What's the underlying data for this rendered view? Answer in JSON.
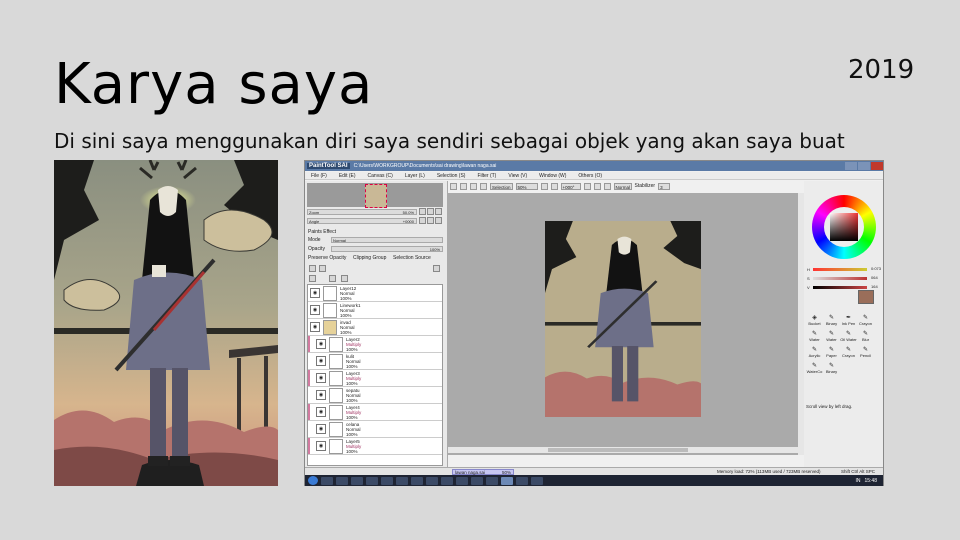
{
  "slide": {
    "title": "Karya saya",
    "year": "2019",
    "subtitle": "Di sini saya menggunakan diri saya sendiri sebagai  objek yang akan saya buat"
  },
  "sai": {
    "logo": "PaintTool SAI",
    "path": "C:\\Users\\WORKGROUP\\Documents\\sai drawing\\lawan naga.sai",
    "menu": [
      "File (F)",
      "Edit (E)",
      "Canvas (C)",
      "Layer (L)",
      "Selection (S)",
      "Filter (T)",
      "View (V)",
      "Window (W)",
      "Others (O)"
    ],
    "nav": {
      "zoom_label": "Zoom",
      "zoom_value": "50.0%",
      "angle_label": "Angle",
      "angle_value": "+0000"
    },
    "paints_effect": "Paints Effect",
    "mode_label": "Mode",
    "mode_value": "Normal",
    "opacity_label": "Opacity",
    "opacity_value": "100%",
    "checks": [
      "Preserve Opacity",
      "Clipping Group",
      "Selection Source"
    ],
    "layers": [
      {
        "name": "Layer12",
        "mode": "Normal",
        "opacity": "100%",
        "type": "layer"
      },
      {
        "name": "Linework1",
        "mode": "Normal",
        "opacity": "100%",
        "type": "layer"
      },
      {
        "name": "invad",
        "mode": "Normal",
        "opacity": "100%",
        "type": "folder"
      },
      {
        "name": "Layer2",
        "mode": "Multiply",
        "opacity": "100%",
        "type": "layer"
      },
      {
        "name": "kulit",
        "mode": "Normal",
        "opacity": "100%",
        "type": "layer"
      },
      {
        "name": "Layer3",
        "mode": "Multiply",
        "opacity": "100%",
        "type": "layer"
      },
      {
        "name": "sepatu",
        "mode": "Normal",
        "opacity": "100%",
        "type": "layer"
      },
      {
        "name": "Layer4",
        "mode": "Multiply",
        "opacity": "100%",
        "type": "layer"
      },
      {
        "name": "celana",
        "mode": "Normal",
        "opacity": "100%",
        "type": "layer"
      },
      {
        "name": "Layer5",
        "mode": "Multiply",
        "opacity": "100%",
        "type": "layer"
      }
    ],
    "toolbar": {
      "selection_label": "Selection",
      "zoom": "50%",
      "angle": "+000°",
      "blend": "Normal",
      "stabilizer_label": "Stabilizer",
      "stabilizer_value": "3"
    },
    "color": {
      "h": "H",
      "h_val": "0:073",
      "s": "S",
      "s_val": "064",
      "v": "V",
      "v_val": "164",
      "swatch": "#9a6e5a"
    },
    "tools": [
      {
        "label": "Bucket",
        "glyph": "◈"
      },
      {
        "label": "Binary",
        "glyph": "✎"
      },
      {
        "label": "Ink Pen",
        "glyph": "✒"
      },
      {
        "label": "Crayon",
        "glyph": "✎"
      },
      {
        "label": "Water",
        "glyph": "✎"
      },
      {
        "label": "Water",
        "glyph": "✎"
      },
      {
        "label": "Oil Water",
        "glyph": "✎"
      },
      {
        "label": "Blur",
        "glyph": "✎"
      },
      {
        "label": "Acrylic",
        "glyph": "✎"
      },
      {
        "label": "Paper",
        "glyph": "✎"
      },
      {
        "label": "Crayon",
        "glyph": "✎"
      },
      {
        "label": "Pencil",
        "glyph": "✎"
      },
      {
        "label": "WaterCo",
        "glyph": "✎"
      },
      {
        "label": "Binary",
        "glyph": "✎"
      }
    ],
    "hint": "Scroll view by left drag.",
    "doc_tab": "lawan naga.sai",
    "doc_zoom": "50%",
    "memory": "Memory load: 72% (113MB used / 723MB reserved)",
    "flags": "Shift Ctrl Alt SPC Any",
    "clock": "15:48",
    "tray_lang": "IN"
  }
}
